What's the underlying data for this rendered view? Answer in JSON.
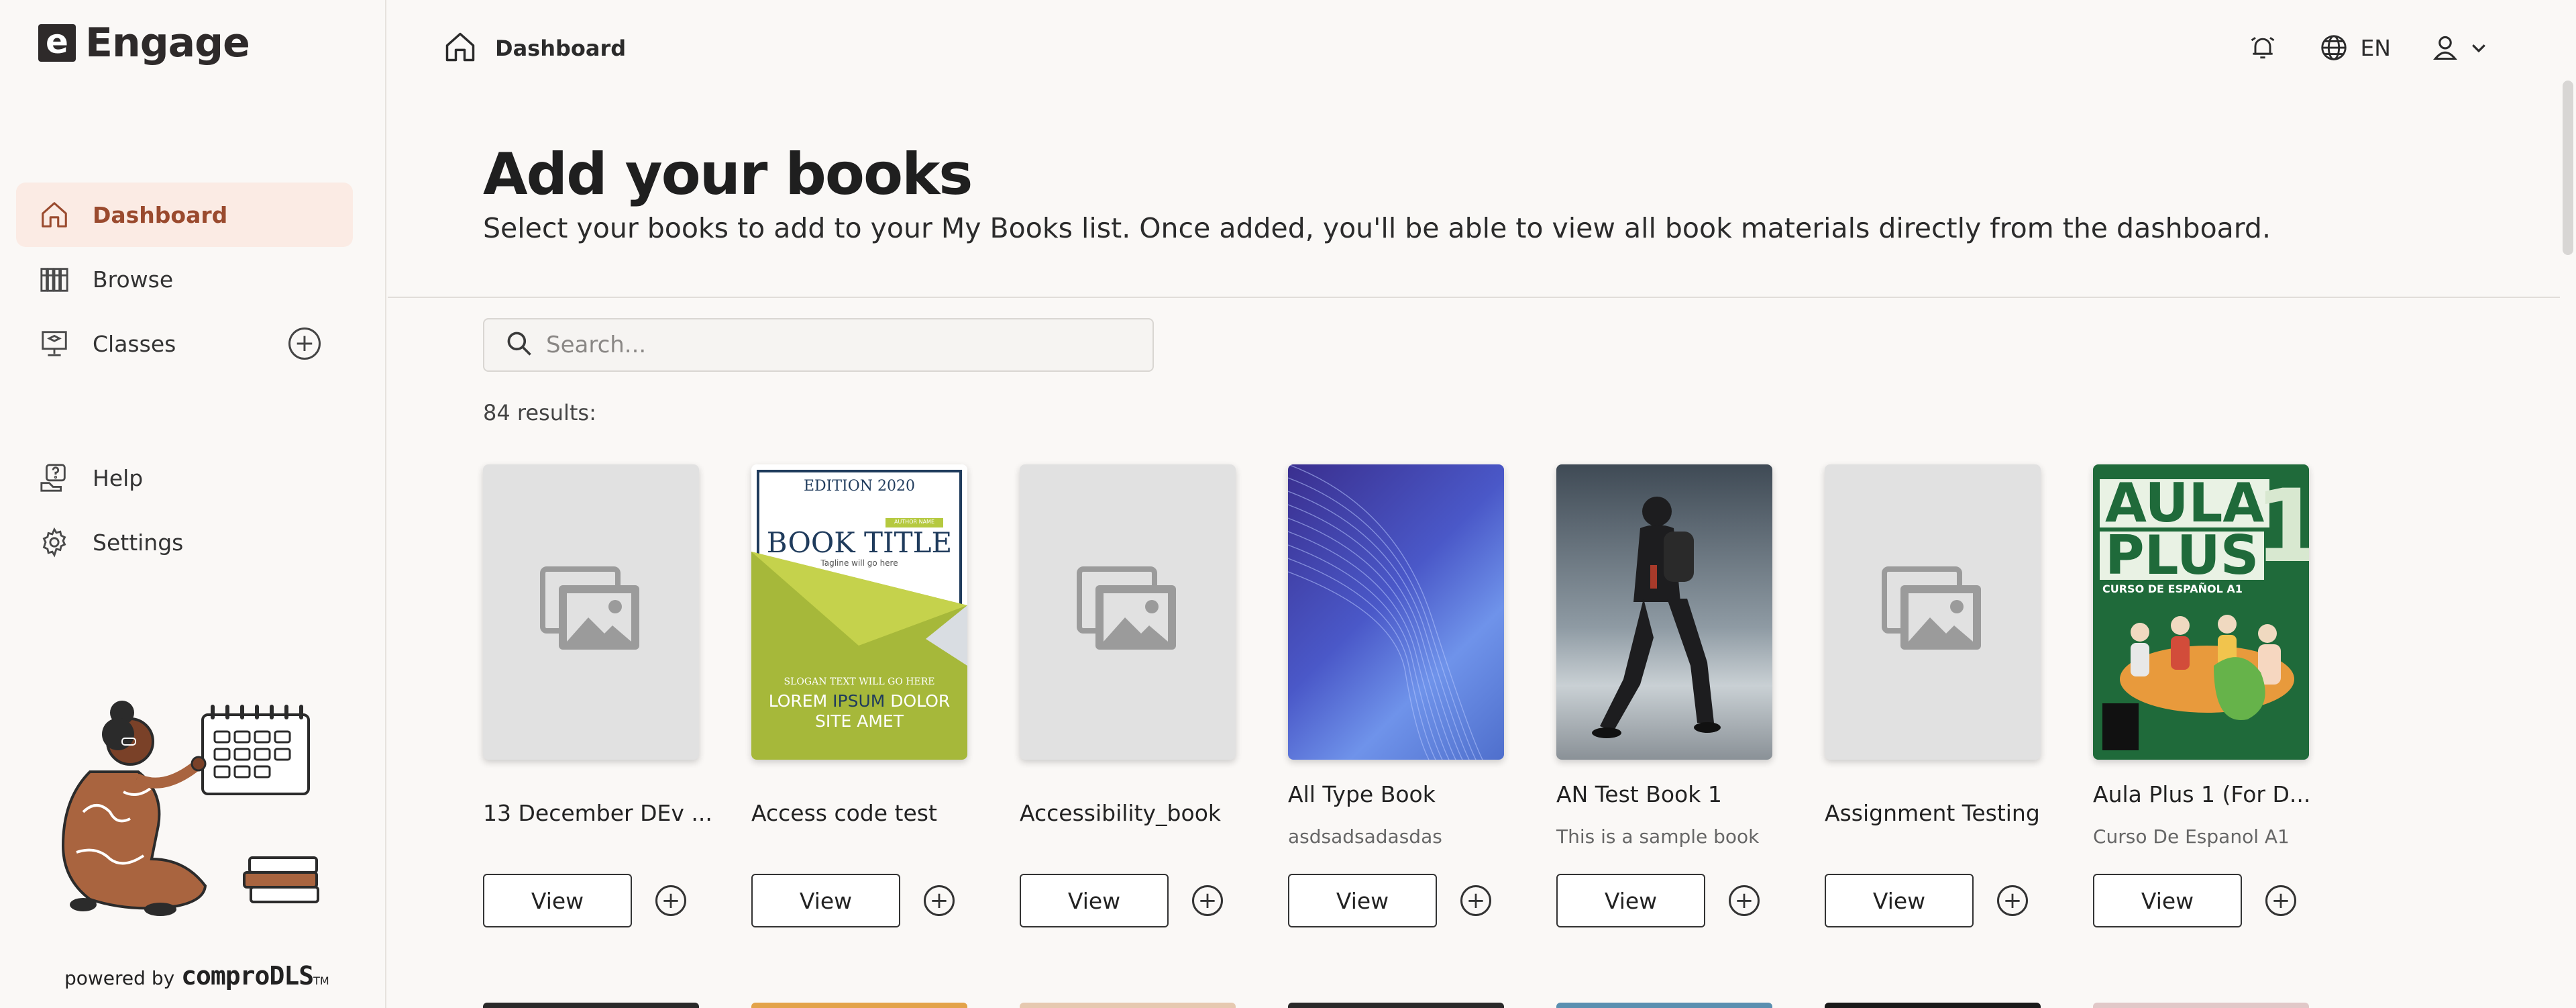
{
  "brand": {
    "mark": "e",
    "name": "Engage"
  },
  "sidebar": {
    "items": [
      {
        "label": "Dashboard",
        "icon": "home-icon",
        "active": true
      },
      {
        "label": "Browse",
        "icon": "library-icon"
      },
      {
        "label": "Classes",
        "icon": "classroom-icon",
        "has_add": true
      },
      {
        "label": "Help",
        "icon": "help-icon"
      },
      {
        "label": "Settings",
        "icon": "gear-icon"
      }
    ],
    "powered_prefix": "powered by",
    "powered_brand": "comproDLS",
    "powered_tm": "TM"
  },
  "topbar": {
    "breadcrumb": "Dashboard",
    "language": "EN",
    "icons": [
      "alarm-bell-icon",
      "globe-icon",
      "user-icon",
      "chevron-down-icon"
    ]
  },
  "header": {
    "title": "Add your books",
    "subtitle": "Select your books to add to your My Books list. Once added, you'll be able to view all book materials directly from the dashboard."
  },
  "search": {
    "placeholder": "Search..."
  },
  "results_label": "84 results:",
  "books": [
    {
      "title": "13 December DEv ...",
      "subtitle": "",
      "cover": "placeholder",
      "view": "View"
    },
    {
      "title": "Access code test",
      "subtitle": "",
      "cover": "book-title",
      "view": "View",
      "cover_text": {
        "edition": "EDITION 2020",
        "badge": "AUTHOR NAME",
        "heading": "BOOK TITLE",
        "tagline": "Tagline will go here",
        "slogan": "SLOGAN TEXT WILL GO HERE",
        "lorem1": "LOREM",
        "lorem2": "IPSUM",
        "lorem3": "DOLOR",
        "lorem4": "SITE AMET"
      }
    },
    {
      "title": "Accessibility_book",
      "subtitle": "",
      "cover": "placeholder",
      "view": "View"
    },
    {
      "title": "All Type Book",
      "subtitle": "asdsadsadasdas",
      "cover": "blue-waves",
      "view": "View"
    },
    {
      "title": "AN Test Book 1",
      "subtitle": "This is a sample book",
      "cover": "hiker",
      "view": "View"
    },
    {
      "title": "Assignment Testing",
      "subtitle": "",
      "cover": "placeholder",
      "view": "View"
    },
    {
      "title": "Aula Plus 1 (For D...",
      "subtitle": "Curso De Espanol A1",
      "cover": "aula-plus",
      "view": "View",
      "cover_text": {
        "line1": "AULA",
        "line2": "PLUS",
        "num": "1",
        "caption": "CURSO DE ESPAÑOL A1"
      }
    }
  ],
  "colors": {
    "accent": "#9a4a2e",
    "active_bg": "#fbebe4",
    "page_bg": "#faf8f6"
  }
}
